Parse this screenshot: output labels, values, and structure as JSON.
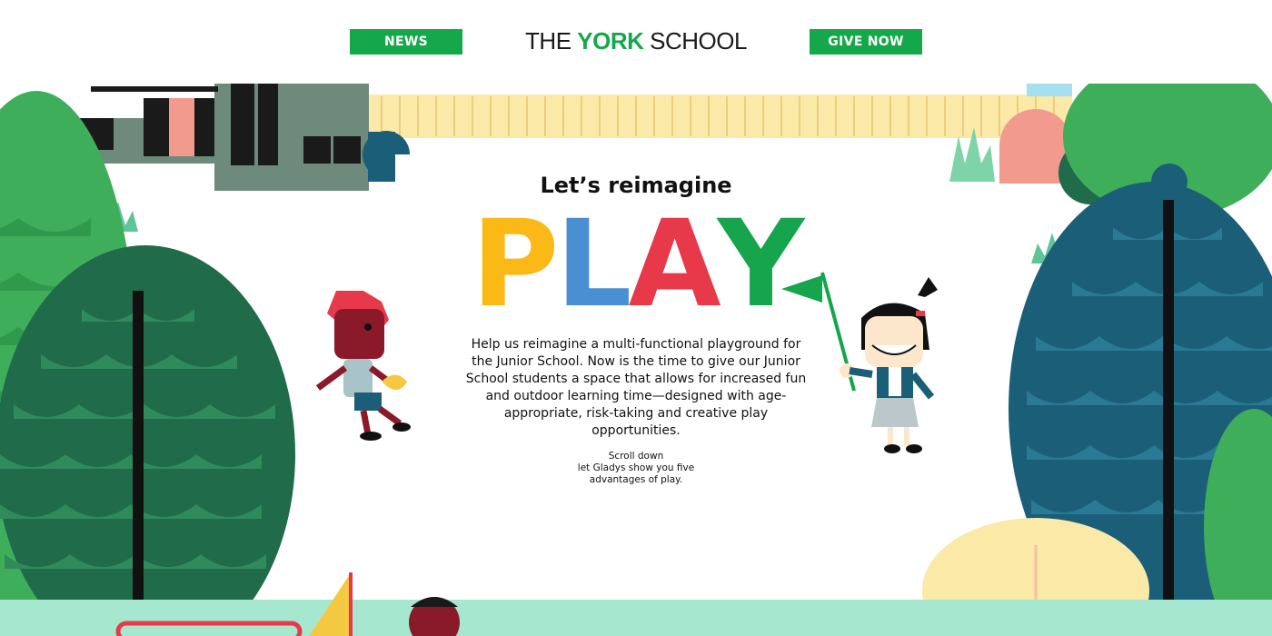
{
  "header": {
    "news_label": "NEWS",
    "give_label": "GIVE NOW",
    "logo": {
      "part1": "THE ",
      "part2": "YORK",
      "part3": " SCHOOL"
    }
  },
  "hero": {
    "kicker": "Let’s reimagine",
    "play_letters": [
      {
        "char": "P",
        "color": "#fbb917"
      },
      {
        "char": "L",
        "color": "#4a8fd1"
      },
      {
        "char": "A",
        "color": "#e8394a"
      },
      {
        "char": "Y",
        "color": "#16a44c"
      }
    ],
    "body": "Help us reimagine a multi-functional playground for the Junior School. Now is the time to give our Junior School students a space that allows for increased fun and outdoor learning time—designed with age-appropriate, risk-taking and creative play opportunities.",
    "scroll_hint": [
      "Scroll down",
      "let Gladys show you five",
      "advantages of play."
    ]
  },
  "colors": {
    "brand_green": "#14a84a",
    "tree_dark": "#1f6b4a",
    "tree_teal": "#1b5e78",
    "tree_light": "#3fae5a",
    "fence": "#fbe9a8"
  },
  "icons": [
    "tree-icon",
    "building-icon",
    "kid-boy-icon",
    "kid-girl-icon",
    "flag-icon"
  ]
}
